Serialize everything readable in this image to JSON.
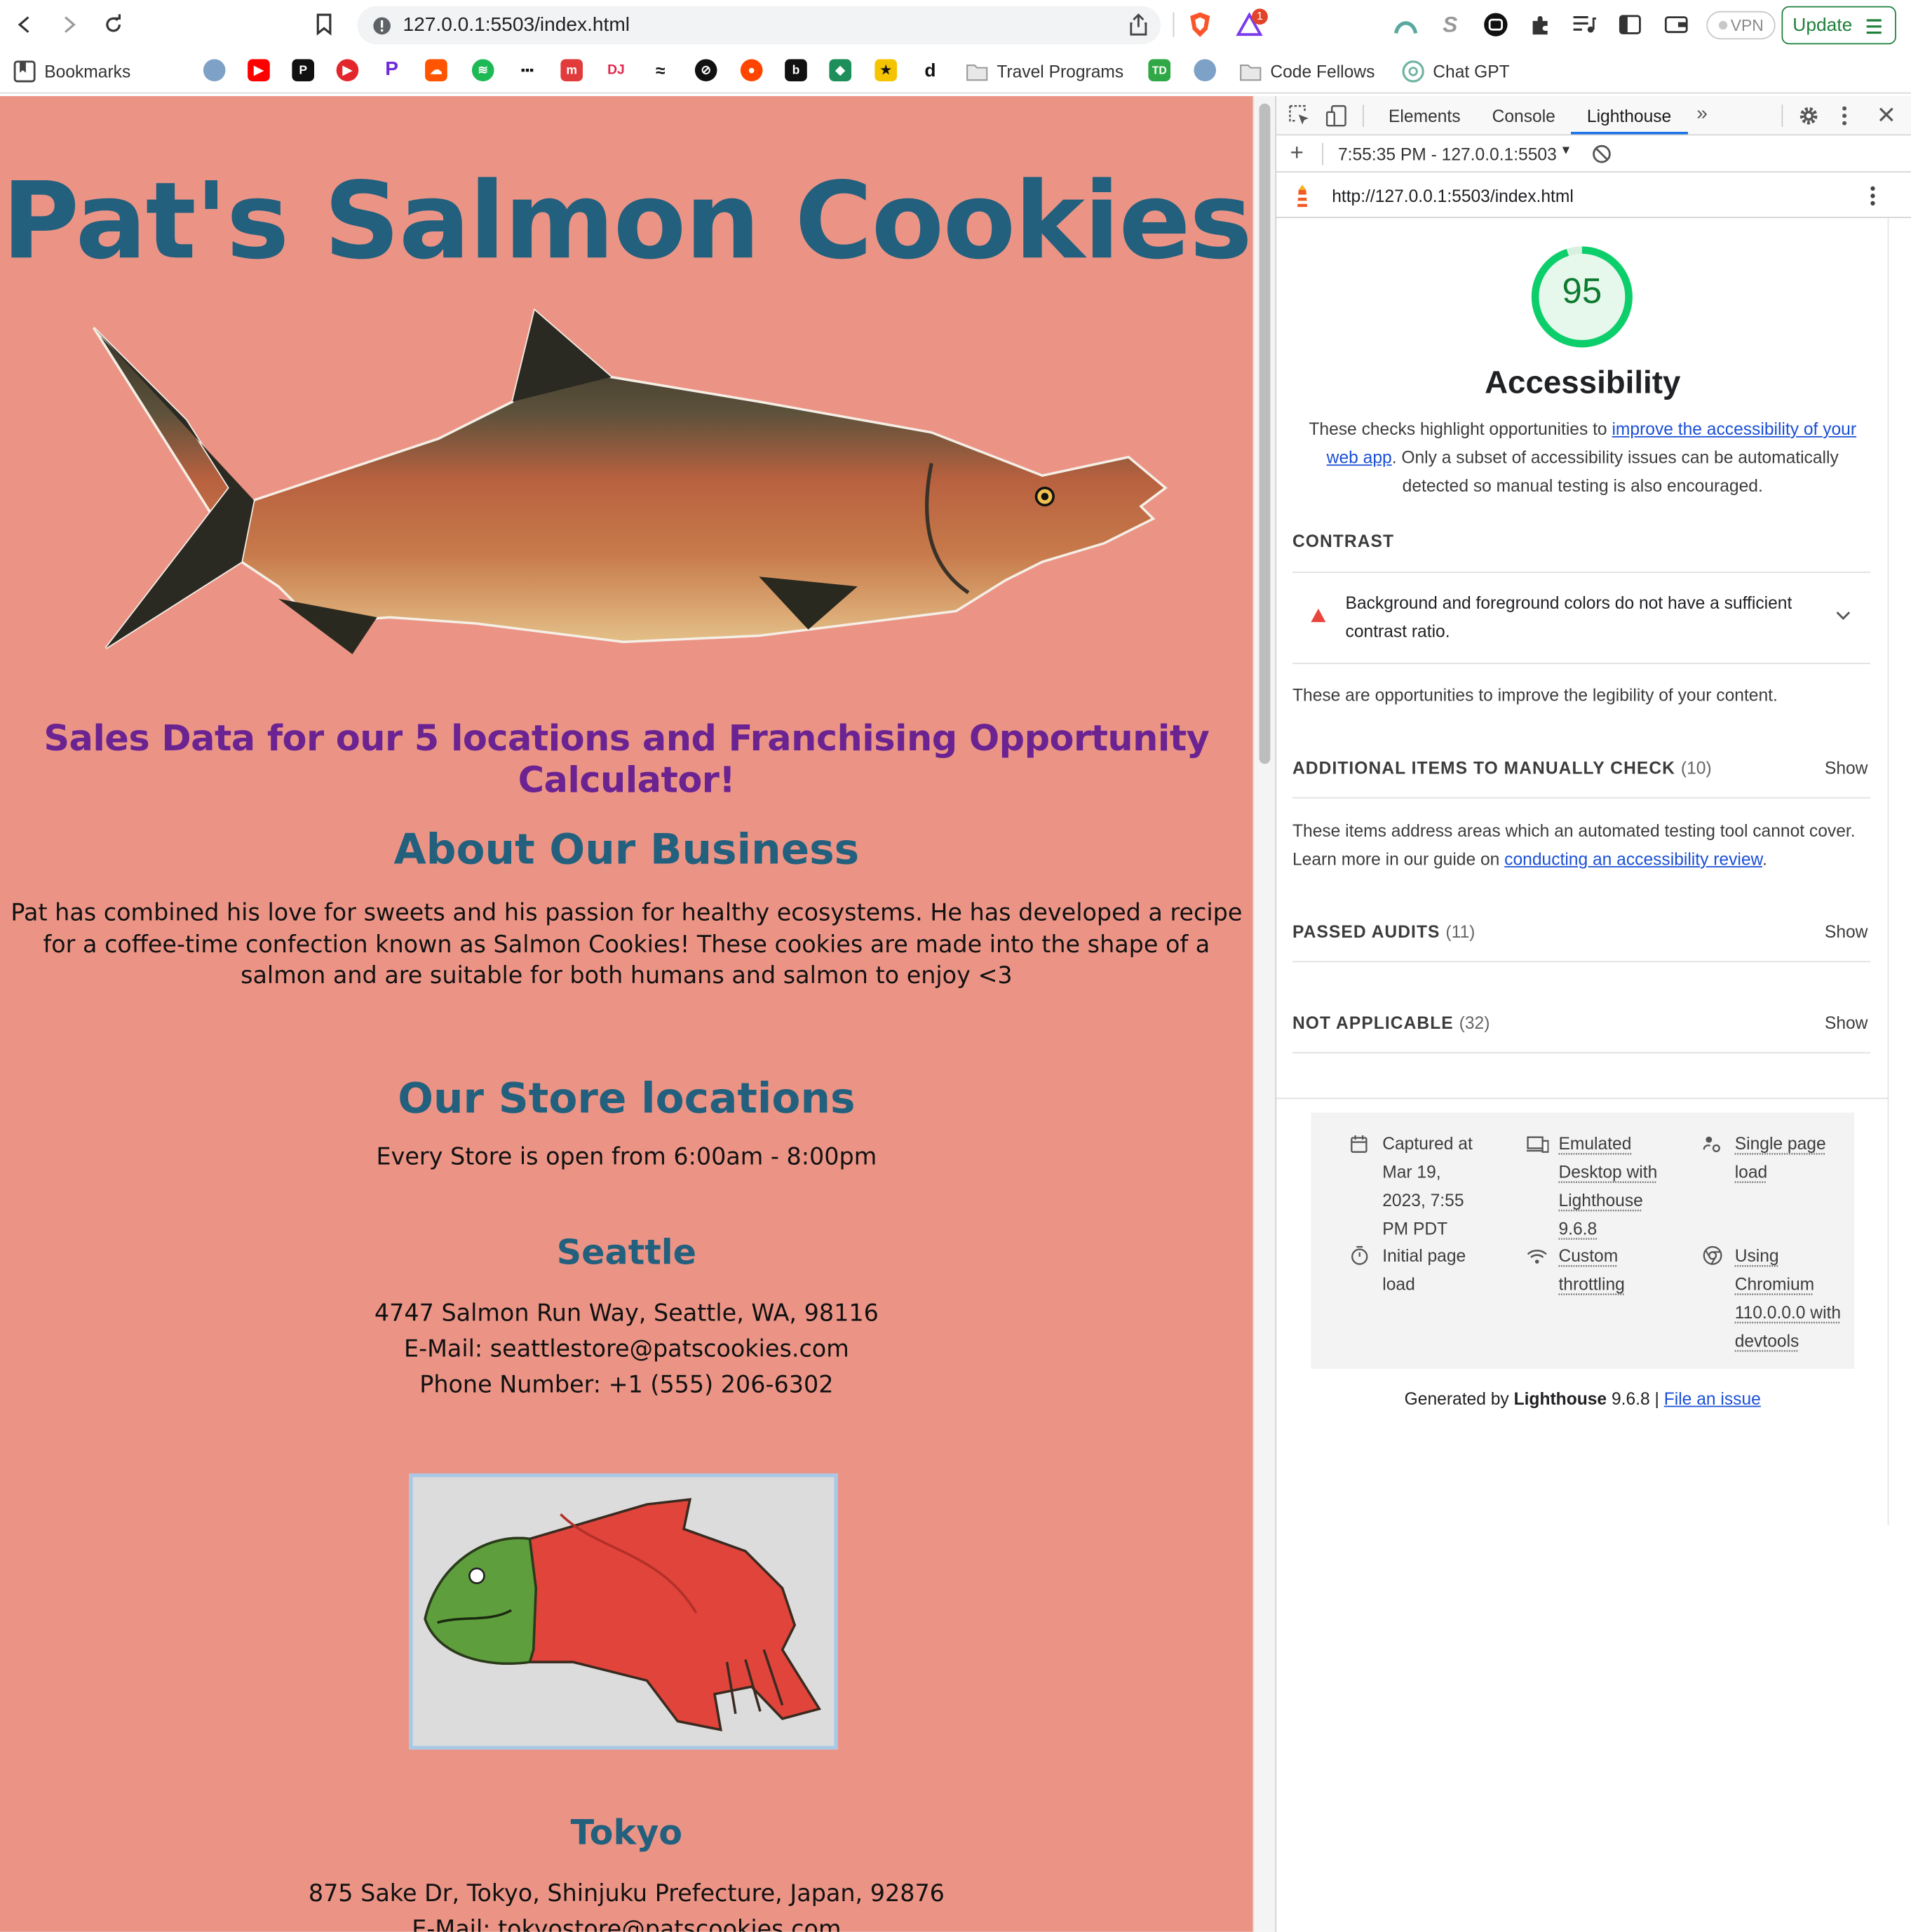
{
  "browser": {
    "url": "127.0.0.1:5503/index.html",
    "vpn_label": "VPN",
    "update_label": "Update",
    "brave_badge": "1"
  },
  "bookmarks": {
    "label": "Bookmarks",
    "folders": [
      "Travel Programs",
      "Code Fellows"
    ],
    "chat_gpt": "Chat GPT"
  },
  "page": {
    "site_title": "Pat's Salmon Cookies",
    "tagline": "Sales Data for our 5 locations and Franchising Opportunity Calculator!",
    "about_heading": "About Our Business",
    "about_text": "Pat has combined his love for sweets and his passion for healthy ecosystems. He has developed a recipe for a coffee-time confection known as Salmon Cookies! These cookies are made into the shape of a salmon and are suitable for both humans and salmon to enjoy <3",
    "stores_heading": "Our Store locations",
    "hours": "Every Store is open from 6:00am - 8:00pm",
    "stores": [
      {
        "city": "Seattle",
        "address": "4747 Salmon Run Way, Seattle, WA, 98116",
        "email": "E-Mail: seattlestore@patscookies.com",
        "phone": "Phone Number: +1 (555) 206-6302"
      },
      {
        "city": "Tokyo",
        "address": "875 Sake Dr, Tokyo, Shinjuku Prefecture, Japan, 92876",
        "email": "E-Mail: tokyostore@patscookies.com"
      }
    ]
  },
  "devtools": {
    "tabs": [
      "Elements",
      "Console",
      "Lighthouse"
    ],
    "active_tab": "Lighthouse",
    "report_selector": "7:55:35 PM - 127.0.0.1:5503",
    "report_url": "http://127.0.0.1:5503/index.html",
    "score": "95",
    "score_color": "#0cce6b",
    "category_title": "Accessibility",
    "desc_pre": "These checks highlight opportunities to ",
    "desc_link": "improve the accessibility of your web app",
    "desc_post": ". Only a subset of accessibility issues can be automatically detected so manual testing is also encouraged.",
    "contrast_heading": "CONTRAST",
    "contrast_audit": "Background and foreground colors do not have a sufficient contrast ratio.",
    "contrast_note": "These are opportunities to improve the legibility of your content.",
    "manual_heading": "ADDITIONAL ITEMS TO MANUALLY CHECK",
    "manual_count": "(10)",
    "manual_note_pre": "These items address areas which an automated testing tool cannot cover. Learn more in our guide on ",
    "manual_note_link": "conducting an accessibility review",
    "manual_note_post": ".",
    "passed_heading": "PASSED AUDITS",
    "passed_count": "(11)",
    "na_heading": "NOT APPLICABLE",
    "na_count": "(32)",
    "show_label": "Show",
    "meta": {
      "captured": "Captured at Mar 19, 2023, 7:55 PM PDT",
      "emulated": "Emulated Desktop with Lighthouse 9.6.8",
      "single": "Single page load",
      "initial": "Initial page load",
      "throttling": "Custom throttling",
      "chromium": "Using Chromium 110.0.0.0 with devtools"
    },
    "footer_pre": "Generated by ",
    "footer_brand": "Lighthouse",
    "footer_version": " 9.6.8 | ",
    "footer_link": "File an issue"
  }
}
